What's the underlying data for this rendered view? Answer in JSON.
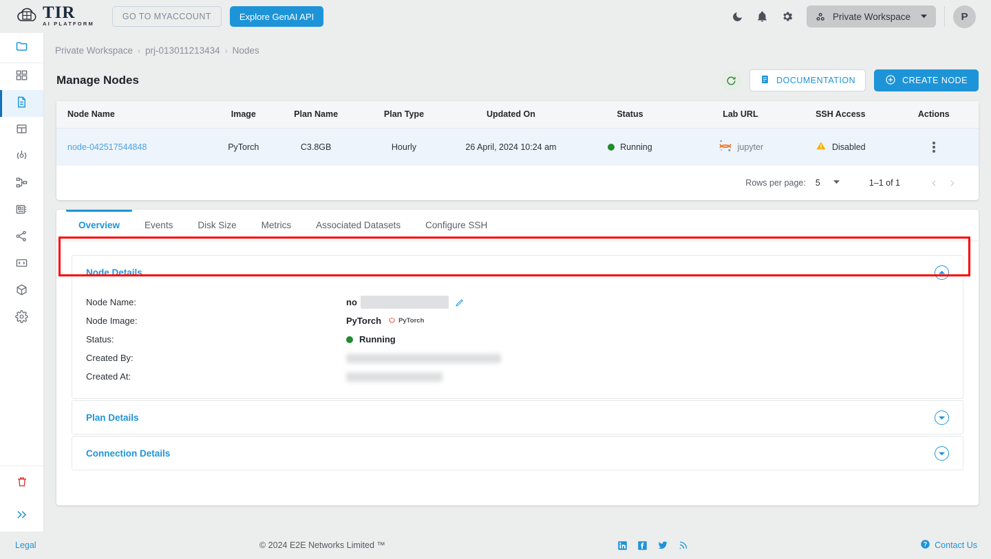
{
  "header": {
    "logo_title": "TIR",
    "logo_subtitle": "AI PLATFORM",
    "myaccount_label": "GO TO MYACCOUNT",
    "genai_label": "Explore GenAI API",
    "workspace_label": "Private Workspace",
    "avatar_initial": "P",
    "icons": {
      "dark_mode": "moon-icon",
      "notifications": "bell-icon",
      "settings": "gear-icon",
      "workspace": "nodes-icon",
      "caret": "chevron-down-icon"
    }
  },
  "sidebar": {
    "items": [
      {
        "name": "projects",
        "icon": "folder-icon"
      },
      {
        "name": "dashboard",
        "icon": "grid-icon"
      },
      {
        "name": "nodes",
        "icon": "document-icon",
        "active": true
      },
      {
        "name": "datasets",
        "icon": "table-icon"
      },
      {
        "name": "model-endpoints",
        "icon": "target-icon"
      },
      {
        "name": "pipelines",
        "icon": "hierarchy-icon"
      },
      {
        "name": "inference",
        "icon": "server-icon"
      },
      {
        "name": "api-tokens",
        "icon": "share-icon"
      },
      {
        "name": "code-snippets",
        "icon": "code-box-icon"
      },
      {
        "name": "containers",
        "icon": "cube-icon"
      },
      {
        "name": "settings",
        "icon": "gear-icon"
      }
    ],
    "trash": {
      "name": "trash",
      "icon": "trash-icon"
    },
    "expand": {
      "name": "expand-sidebar",
      "icon": "double-chevron-right-icon"
    }
  },
  "breadcrumb": {
    "items": [
      "Private Workspace",
      "prj-013011213434",
      "Nodes"
    ],
    "separator": "›"
  },
  "page": {
    "title": "Manage Nodes",
    "refresh_icon": "refresh-icon",
    "documentation_label": "DOCUMENTATION",
    "documentation_icon": "document-lines-icon",
    "create_node_label": "CREATE NODE",
    "create_node_icon": "plus-circle-icon"
  },
  "table": {
    "columns": [
      "Node Name",
      "Image",
      "Plan Name",
      "Plan Type",
      "Updated On",
      "Status",
      "Lab URL",
      "SSH Access",
      "Actions"
    ],
    "rows": [
      {
        "node_name": "node-042517544848",
        "image": "PyTorch",
        "plan_name": "C3.8GB",
        "plan_type": "Hourly",
        "updated_on": "26 April, 2024 10:24 am",
        "status": "Running",
        "status_color": "#1f8c2e",
        "lab_url": "jupyter",
        "lab_url_icon": "jupyter-icon",
        "ssh_access": "Disabled",
        "ssh_icon": "warning-triangle-icon",
        "actions_icon": "kebab-menu-icon"
      }
    ],
    "highlight_color": "#fb0000"
  },
  "pagination": {
    "rows_per_page_label": "Rows per page:",
    "rows_per_page_value": "5",
    "range_label": "1–1 of 1",
    "prev_icon": "chevron-left-icon",
    "next_icon": "chevron-right-icon"
  },
  "tabs": [
    {
      "label": "Overview",
      "active": true
    },
    {
      "label": "Events",
      "active": false
    },
    {
      "label": "Disk Size",
      "active": false
    },
    {
      "label": "Metrics",
      "active": false
    },
    {
      "label": "Associated Datasets",
      "active": false
    },
    {
      "label": "Configure SSH",
      "active": false
    }
  ],
  "panels": [
    {
      "title": "Node Details",
      "expanded": true,
      "toggle_icon": "chevron-up-circle-icon",
      "fields": [
        {
          "label": "Node Name:",
          "value": "no",
          "redacted": true,
          "editable": true,
          "edit_icon": "pencil-icon"
        },
        {
          "label": "Node Image:",
          "value": "PyTorch",
          "badge": "PyTorch",
          "badge_icon": "pytorch-icon"
        },
        {
          "label": "Status:",
          "value": "Running",
          "status_color": "#1f8c2e"
        },
        {
          "label": "Created By:",
          "value": "",
          "redacted": true
        },
        {
          "label": "Created At:",
          "value": "",
          "redacted": true
        }
      ]
    },
    {
      "title": "Plan Details",
      "expanded": false,
      "toggle_icon": "chevron-down-circle-icon"
    },
    {
      "title": "Connection Details",
      "expanded": false,
      "toggle_icon": "chevron-down-circle-icon"
    }
  ],
  "footer": {
    "legal": "Legal",
    "copyright": "© 2024 E2E Networks Limited ™",
    "social": [
      {
        "name": "linkedin-icon"
      },
      {
        "name": "facebook-icon"
      },
      {
        "name": "twitter-icon"
      },
      {
        "name": "rss-icon"
      }
    ],
    "contact_label": "Contact Us",
    "contact_icon": "help-circle-icon"
  },
  "colors": {
    "accent": "#1e94d8",
    "success": "#1f8c2e",
    "warning": "#f4b400",
    "danger": "#fb0000",
    "page_bg": "#eceded"
  }
}
